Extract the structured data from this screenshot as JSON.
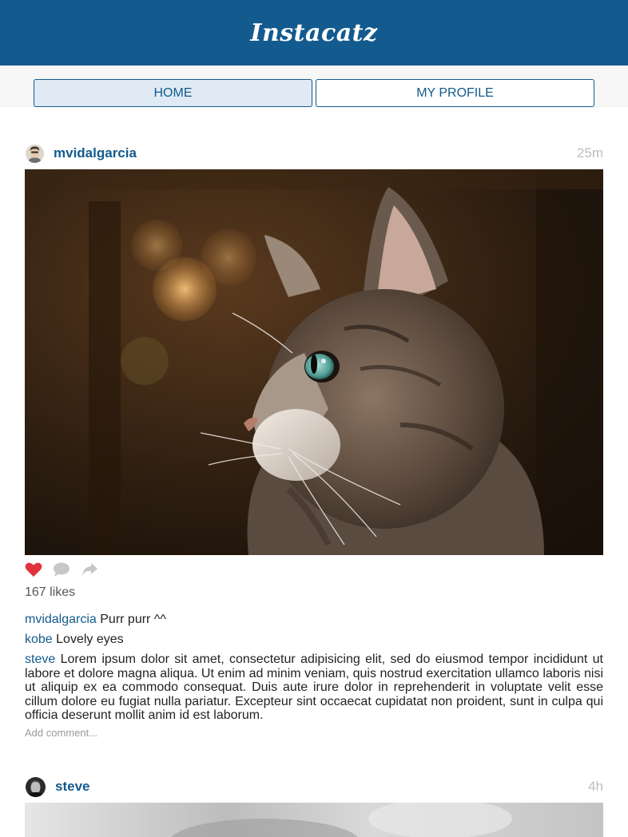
{
  "header": {
    "logo": "Instacatz"
  },
  "nav": {
    "home": "HOME",
    "profile": "MY PROFILE"
  },
  "posts": [
    {
      "username": "mvidalgarcia",
      "time": "25m",
      "likes": "167 likes",
      "liked": true,
      "comments": [
        {
          "user": "mvidalgarcia",
          "text": " Purr purr ^^"
        },
        {
          "user": "kobe",
          "text": " Lovely eyes"
        },
        {
          "user": "steve",
          "text": " Lorem ipsum dolor sit amet, consectetur adipisicing elit, sed do eiusmod tempor incididunt ut labore et dolore magna aliqua. Ut enim ad minim veniam, quis nostrud exercitation ullamco laboris nisi ut aliquip ex ea commodo consequat. Duis aute irure dolor in reprehenderit in voluptate velit esse cillum dolore eu fugiat nulla pariatur. Excepteur sint occaecat cupidatat non proident, sunt in culpa qui officia deserunt mollit anim id est laborum."
        }
      ],
      "add_comment_placeholder": "Add comment..."
    },
    {
      "username": "steve",
      "time": "4h"
    }
  ],
  "colors": {
    "brand": "#135a8e",
    "heart": "#e0333c",
    "muted": "#bdbdbd"
  },
  "icons": [
    "heart-icon",
    "comment-icon",
    "share-icon"
  ]
}
